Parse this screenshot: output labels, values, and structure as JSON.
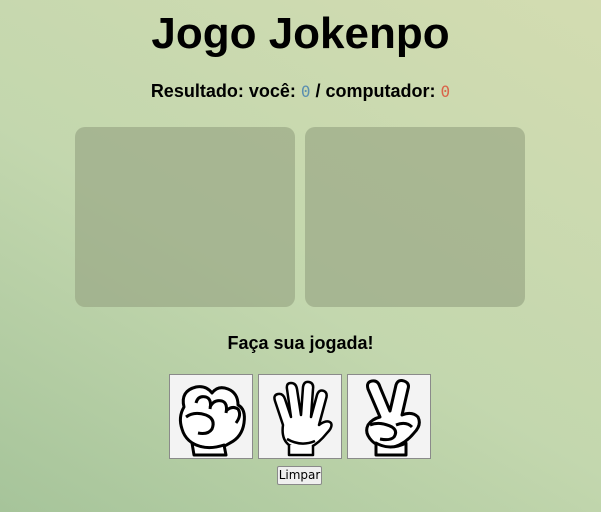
{
  "title": "Jogo Jokenpo",
  "score": {
    "label": "Resultado: você:",
    "separator": "/ computador:",
    "player": "0",
    "computer": "0",
    "player_color": "#5b8fb0",
    "computer_color": "#d9644a"
  },
  "prompt": "Faça sua jogada!",
  "choices": [
    {
      "name": "rock",
      "icon": "fist-hand-icon"
    },
    {
      "name": "paper",
      "icon": "open-hand-icon"
    },
    {
      "name": "scissors",
      "icon": "peace-hand-icon"
    }
  ],
  "clear_button": "Limpar"
}
